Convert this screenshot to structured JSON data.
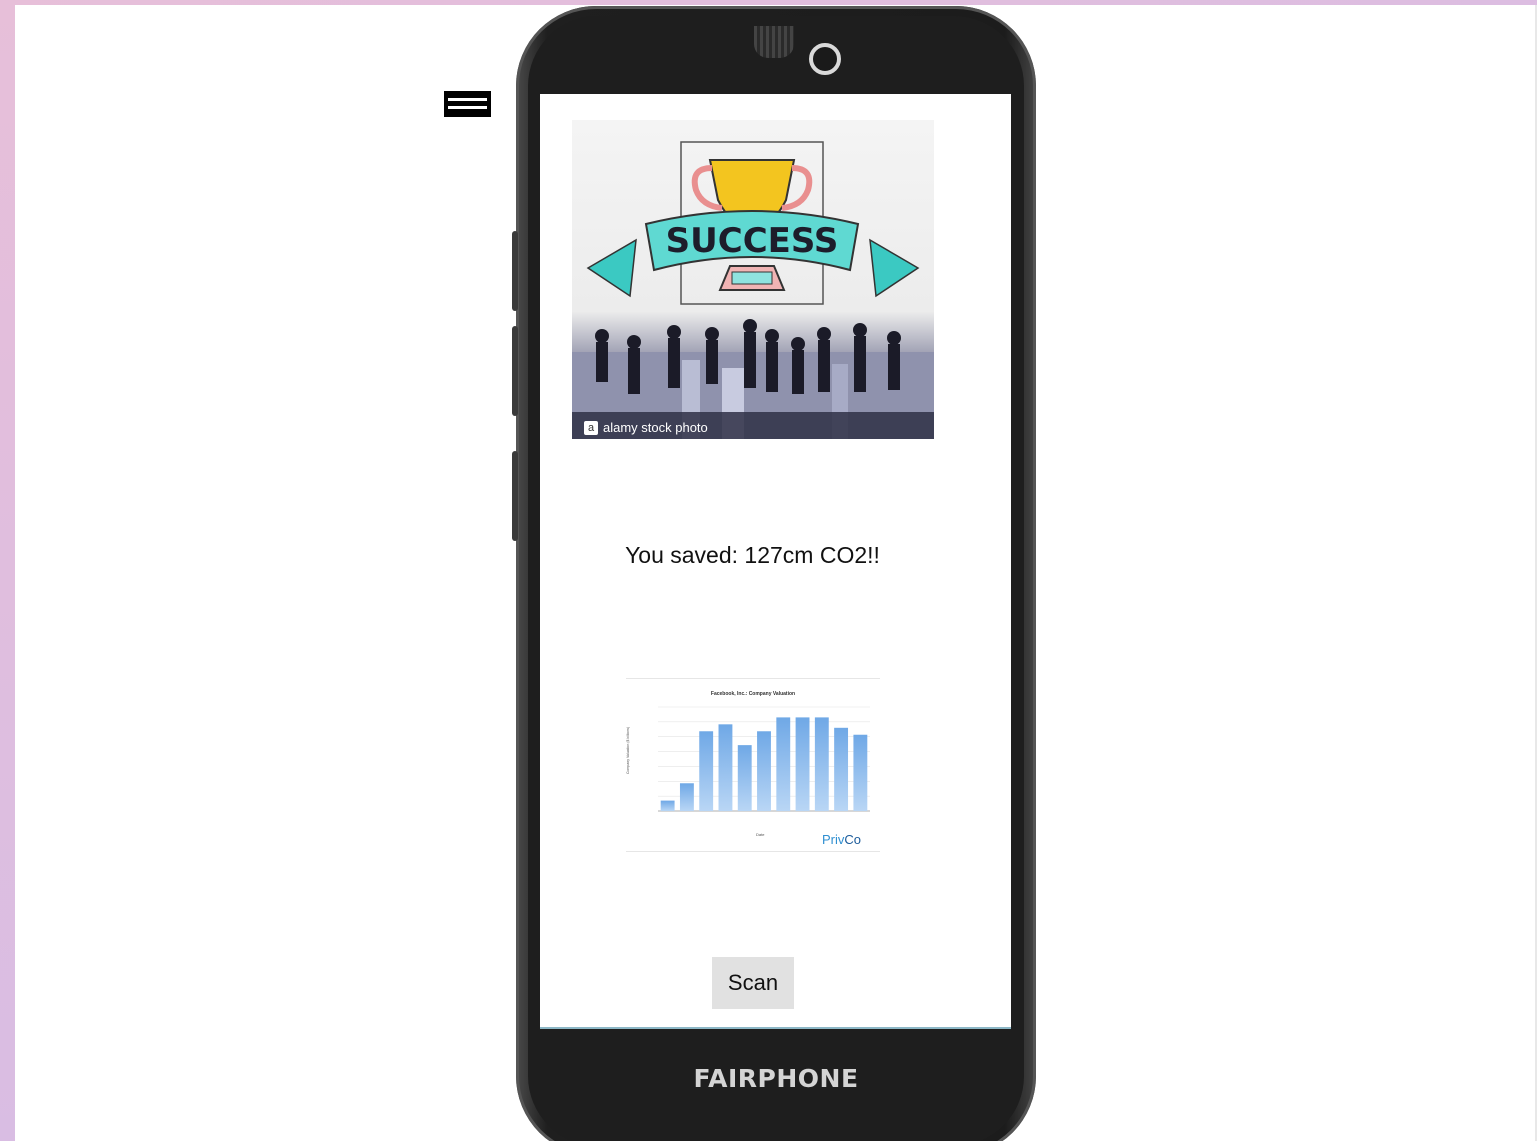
{
  "image_watermark": "alamy stock photo",
  "image_banner_text": "SUCCESS",
  "result": {
    "saved_text": "You saved: 127cm CO2!!"
  },
  "chart_branding": {
    "privco_prefix": "Priv",
    "privco_suffix": "Co"
  },
  "chart_data": {
    "type": "bar",
    "title": "Facebook, Inc.: Company Valuation",
    "ylabel": "Company Valuation ($ billions)",
    "xlabel": "Date",
    "values": [
      50,
      55,
      70,
      72,
      66,
      70,
      74,
      74,
      74,
      71,
      69
    ],
    "ylim": [
      47,
      77
    ],
    "bar_color": "#6fa8e6"
  },
  "scan": {
    "label": "Scan"
  },
  "device": {
    "brand": "FAIRPHONE"
  },
  "colors": {
    "accent_privco": "#2f8fd1",
    "button_bg": "#e1e1e1"
  }
}
